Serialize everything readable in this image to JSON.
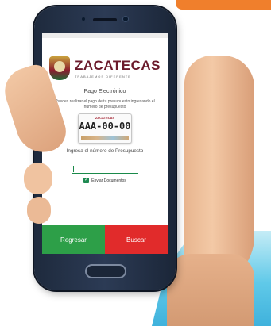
{
  "app": {
    "brand": "ZACATECAS",
    "tagline": "TRABAJEMOS DIFERENTE",
    "screen_title": "Pago Electrónico",
    "description": "Puedes realizar el pago de tu presupuesto ingresando el número de presupuesto",
    "plate_header": "ZACATECAS",
    "plate_number": "AAA-00-00",
    "prompt": "Ingresa el número de Presupuesto",
    "input": {
      "value": ""
    },
    "send_documents": {
      "label": "Enviar Documentos",
      "checked": true
    },
    "buttons": {
      "back": "Regresar",
      "search": "Buscar"
    },
    "colors": {
      "back_button": "#2d9f48",
      "search_button": "#e12b2b",
      "brand": "#6b1a2b",
      "accent_orange": "#f07f2c",
      "accent_cyan": "#4ec3e6"
    }
  }
}
